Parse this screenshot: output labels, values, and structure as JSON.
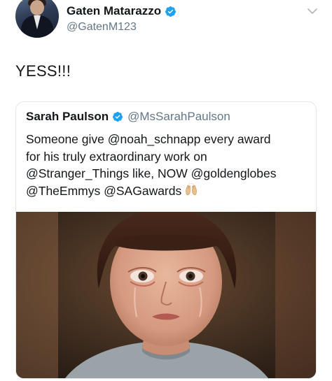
{
  "author": {
    "display_name": "Gaten Matarazzo",
    "handle": "@GatenM123",
    "avatar_icon": "avatar-photo",
    "avatar_backdrop_text": "E"
  },
  "tweet": {
    "text": "YESS!!!"
  },
  "quoted": {
    "display_name": "Sarah Paulson",
    "handle": "@MsSarahPaulson",
    "lines": [
      "Someone give @noah_schnapp every award",
      "for his truly extraordinary work on",
      "@Stranger_Things like, NOW @goldenglobes",
      "@TheEmmys @SAGawards"
    ],
    "emoji": "raising-hands-icon",
    "media_icon": "photo-crying-boy"
  },
  "colors": {
    "verified_blue": "#1da1f2",
    "secondary_text": "#657786",
    "primary_text": "#14171a",
    "border": "#e1e8ed"
  }
}
